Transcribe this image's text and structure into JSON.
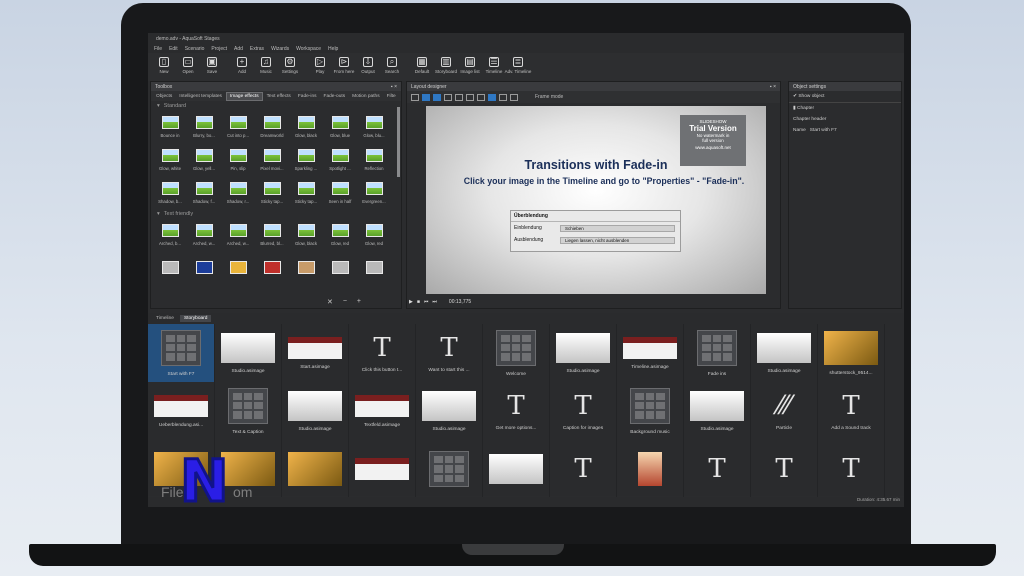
{
  "app": {
    "title": "demo.adv - AquaSoft Stages"
  },
  "menu": [
    "File",
    "Edit",
    "Scenario",
    "Project",
    "Add",
    "Extras",
    "Wizards",
    "Workspace",
    "Help"
  ],
  "toolbar": [
    {
      "label": "New",
      "icon": "new-file-icon"
    },
    {
      "label": "Open",
      "icon": "open-folder-icon"
    },
    {
      "label": "Save",
      "icon": "save-icon"
    },
    {
      "label": "Add",
      "icon": "add-icon"
    },
    {
      "label": "Music",
      "icon": "music-icon"
    },
    {
      "label": "Settings",
      "icon": "gear-icon"
    },
    {
      "label": "Play",
      "icon": "play-icon"
    },
    {
      "label": "From here",
      "icon": "play-from-here-icon"
    },
    {
      "label": "Output",
      "icon": "output-icon"
    },
    {
      "label": "Search",
      "icon": "search-icon"
    },
    {
      "label": "Default",
      "icon": "default-layout-icon"
    },
    {
      "label": "Storyboard",
      "icon": "storyboard-icon"
    },
    {
      "label": "Image list",
      "icon": "image-list-icon"
    },
    {
      "label": "Timeline",
      "icon": "timeline-icon"
    },
    {
      "label": "Adv. Timeline",
      "icon": "adv-timeline-icon"
    }
  ],
  "toolbox": {
    "title": "Toolbox",
    "tabs": [
      "Objects",
      "Intelligent templates",
      "Image effects",
      "Text effects",
      "Fade-ins",
      "Fade-outs",
      "Motion paths",
      "Filte"
    ],
    "active_tab_index": 2,
    "sections": [
      {
        "name": "Standard",
        "items": [
          "Bounce in",
          "Blurry, bo...",
          "Cut into p...",
          "Dreamworld",
          "Glow, black",
          "Glow, blue",
          "Glow, blu...",
          "Glow, white",
          "Glow, yell...",
          "Pin, slip",
          "Pixel movi...",
          "Sparkling ...",
          "Spotlight ...",
          "Reflection",
          "Shadow, b...",
          "Shadow, f...",
          "Shadow, r...",
          "Sticky tap...",
          "Sticky tap...",
          "Seen in half",
          "Evergreen..."
        ]
      },
      {
        "name": "Text friendly",
        "items": [
          "Arched, b...",
          "Arched, w...",
          "Arched, w...",
          "Blurred, bl...",
          "Glow, black",
          "Glow, red",
          "Glow, red",
          "",
          "",
          "",
          "",
          "",
          "",
          ""
        ]
      }
    ]
  },
  "layout": {
    "title": "Layout designer",
    "zoom": "Frame mode",
    "timecode": "00:13,775",
    "watermark": {
      "brand": "SLIDESHOW",
      "title": "Trial Version",
      "line1": "No watermark in",
      "line2": "full version",
      "url": "www.aquasoft.net"
    },
    "slide_title": "Transitions with Fade-in",
    "slide_subtitle": "Click your image in the Timeline and go to \"Properties\" - \"Fade-in\".",
    "form": {
      "header": "Überblendung",
      "rows": [
        {
          "label": "Einblendung",
          "value": "Schieben"
        },
        {
          "label": "Ausblendung",
          "value": "Liegen lassen, nicht ausblenden"
        }
      ]
    }
  },
  "properties": {
    "title": "Object settings",
    "show_object": "Show object",
    "chapter": "Chapter",
    "chapter_header": "Chapter header",
    "name_label": "Name",
    "name_value": "Start with F7"
  },
  "timeline": {
    "tabs": [
      "Timeline",
      "Storyboard"
    ],
    "active_tab_index": 1,
    "row1": [
      {
        "label": "Start with F7",
        "kind": "grid",
        "selected": true
      },
      {
        "label": "Studio.asimage",
        "kind": "photo"
      },
      {
        "label": "Start.asimage",
        "kind": "card"
      },
      {
        "label": "Click this button t...",
        "kind": "T"
      },
      {
        "label": "Want to start this ...",
        "kind": "T"
      },
      {
        "label": "Welcome",
        "kind": "grid"
      },
      {
        "label": "Studio.asimage",
        "kind": "photo"
      },
      {
        "label": "Timeline.asimage",
        "kind": "card"
      },
      {
        "label": "Fade ins",
        "kind": "grid"
      },
      {
        "label": "Studio.asimage",
        "kind": "photo"
      },
      {
        "label": "shutterstock_9514...",
        "kind": "orange"
      }
    ],
    "row2": [
      {
        "label": "Ueberblendung.asi...",
        "kind": "card"
      },
      {
        "label": "Text & Caption",
        "kind": "grid"
      },
      {
        "label": "Studio.asimage",
        "kind": "photo"
      },
      {
        "label": "Textfeld.asimage",
        "kind": "card"
      },
      {
        "label": "Studio.asimage",
        "kind": "photo"
      },
      {
        "label": "Get more options...",
        "kind": "T"
      },
      {
        "label": "Caption for images",
        "kind": "T"
      },
      {
        "label": "Background music",
        "kind": "grid"
      },
      {
        "label": "Studio.asimage",
        "kind": "photo"
      },
      {
        "label": "Particle",
        "kind": "particle"
      },
      {
        "label": "Add a Sound track",
        "kind": "T"
      }
    ],
    "row3": [
      {
        "label": "",
        "kind": "orange"
      },
      {
        "label": "",
        "kind": "orange"
      },
      {
        "label": "",
        "kind": "orange"
      },
      {
        "label": "",
        "kind": "card"
      },
      {
        "label": "",
        "kind": "grid"
      },
      {
        "label": "",
        "kind": "photo"
      },
      {
        "label": "",
        "kind": "T"
      },
      {
        "label": "",
        "kind": "photo2"
      },
      {
        "label": "",
        "kind": "T"
      },
      {
        "label": "",
        "kind": "T"
      },
      {
        "label": "",
        "kind": "T"
      }
    ],
    "status": "Duration: 4:35.67 min"
  },
  "overlay": {
    "logo": "N",
    "text_left": "File",
    "text_right": "om"
  }
}
